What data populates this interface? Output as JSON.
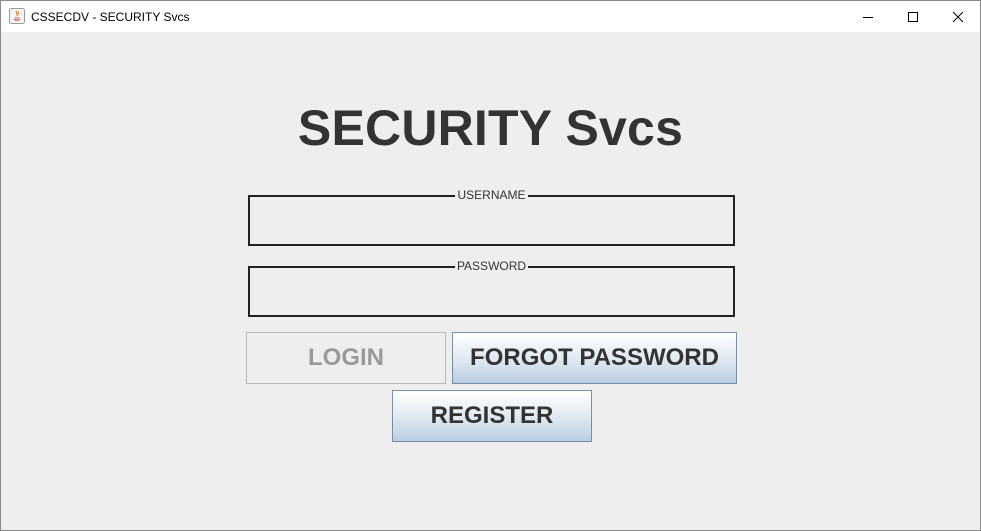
{
  "window": {
    "title": "CSSECDV - SECURITY Svcs",
    "controls": {
      "minimize_icon": "minimize-icon",
      "maximize_icon": "maximize-icon",
      "close_icon": "close-icon"
    }
  },
  "login_form": {
    "heading": "SECURITY Svcs",
    "username": {
      "label": "USERNAME",
      "value": ""
    },
    "password": {
      "label": "PASSWORD",
      "value": ""
    },
    "buttons": {
      "login": "LOGIN",
      "forgot_password": "FORGOT PASSWORD",
      "register": "REGISTER"
    }
  },
  "colors": {
    "background": "#eeeeee",
    "heading_text": "#333333",
    "disabled_text": "#9a9a9a",
    "button_gradient_bottom": "#b9cde1",
    "field_border": "#222222"
  }
}
